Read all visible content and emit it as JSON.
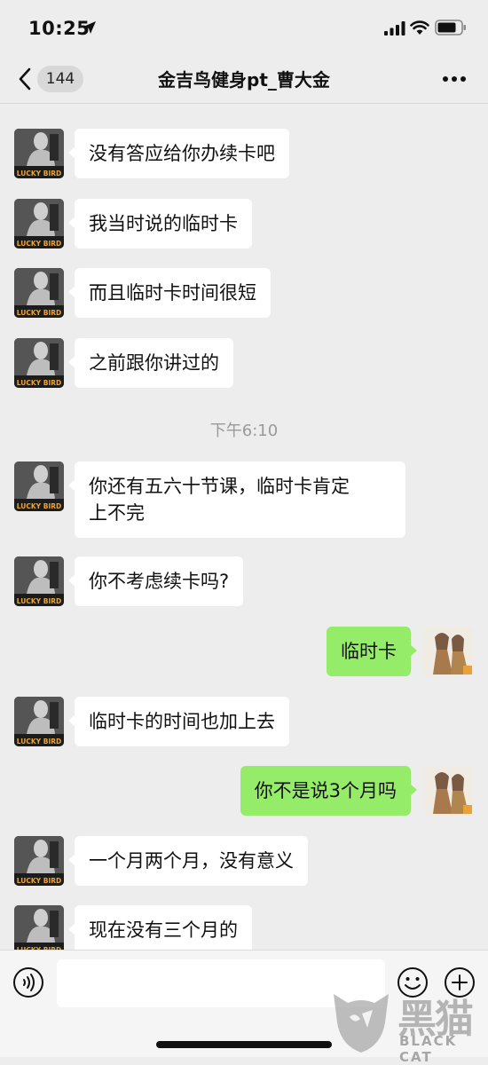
{
  "status_bar": {
    "time": "10:25"
  },
  "nav": {
    "unread_count": "144",
    "title": "金吉鸟健身pt_曹大金"
  },
  "avatar_label": "LUCKY BIRD",
  "messages": [
    {
      "from": "contact",
      "text": "没有答应给你办续卡吧"
    },
    {
      "from": "contact",
      "text": "我当时说的临时卡"
    },
    {
      "from": "contact",
      "text": "而且临时卡时间很短"
    },
    {
      "from": "contact",
      "text": "之前跟你讲过的"
    },
    {
      "from": "contact",
      "text": "你还有五六十节课，临时卡肯定\n上不完"
    },
    {
      "from": "contact",
      "text": "你不考虑续卡吗?"
    },
    {
      "from": "me",
      "text": "临时卡"
    },
    {
      "from": "contact",
      "text": "临时卡的时间也加上去"
    },
    {
      "from": "me",
      "text": "你不是说3个月吗"
    },
    {
      "from": "contact",
      "text": "一个月两个月，没有意义"
    },
    {
      "from": "contact",
      "text": "现在没有三个月的"
    }
  ],
  "timestamp": "下午6:10",
  "input": {
    "value": "",
    "placeholder": ""
  },
  "watermark": {
    "logo": "黑猫",
    "text": "BLACK CAT"
  },
  "colors": {
    "background": "#ededed",
    "incoming_bubble": "#ffffff",
    "outgoing_bubble": "#95ec69"
  },
  "icons": {
    "back": "chevron-left-icon",
    "more": "more-horizontal-icon",
    "voice": "voice-icon",
    "emoji": "emoji-icon",
    "plus": "plus-circle-icon",
    "location": "location-arrow-icon",
    "signal": "cellular-signal-icon",
    "wifi": "wifi-icon",
    "battery": "battery-icon"
  }
}
